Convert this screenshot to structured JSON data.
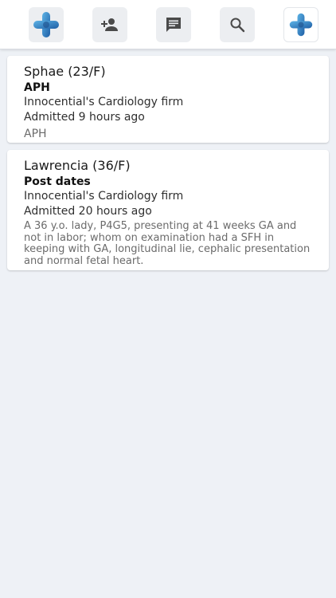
{
  "toolbar": {
    "items": [
      {
        "icon": "app-logo-icon"
      },
      {
        "icon": "add-person-icon"
      },
      {
        "icon": "message-icon"
      },
      {
        "icon": "search-icon"
      },
      {
        "icon": "profile-logo-icon"
      }
    ],
    "colors": {
      "logo_blue": "#2a6db2",
      "logo_light": "#4aa0d8",
      "icon_gray": "#4a4a4a"
    }
  },
  "patients": [
    {
      "name": "Sphae (23/F)",
      "diagnosis": "APH",
      "firm": "Innocential's Cardiology firm",
      "admitted": "Admitted 9 hours ago",
      "note": "APH"
    },
    {
      "name": "Lawrencia (36/F)",
      "diagnosis": "Post dates",
      "firm": "Innocential's Cardiology firm",
      "admitted": "Admitted 20 hours ago",
      "note": "A 36 y.o. lady, P4G5, presenting at 41 weeks GA and not in labor; whom on examination had a SFH in keeping with GA, longitudinal lie, cephalic presentation and normal fetal heart."
    }
  ]
}
